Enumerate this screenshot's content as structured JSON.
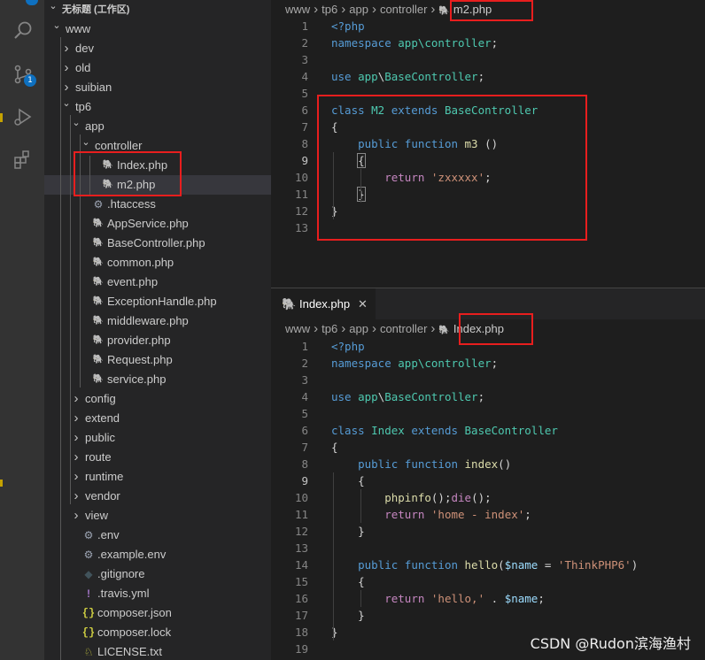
{
  "activity_bar": {
    "icons": [
      "explorer-icon",
      "search-icon",
      "source-control-icon",
      "run-debug-icon",
      "extensions-icon"
    ],
    "scm_badge": "1"
  },
  "sidebar": {
    "workspace_title": "无标题 (工作区)",
    "tree": [
      {
        "label": "www",
        "type": "folder",
        "open": true
      },
      {
        "label": "dev",
        "type": "folder",
        "open": false
      },
      {
        "label": "old",
        "type": "folder",
        "open": false
      },
      {
        "label": "suibian",
        "type": "folder",
        "open": false
      },
      {
        "label": "tp6",
        "type": "folder",
        "open": true
      },
      {
        "label": "app",
        "type": "folder",
        "open": true
      },
      {
        "label": "controller",
        "type": "folder",
        "open": true
      },
      {
        "label": "Index.php",
        "type": "php"
      },
      {
        "label": "m2.php",
        "type": "php",
        "selected": true
      },
      {
        "label": ".htaccess",
        "type": "config"
      },
      {
        "label": "AppService.php",
        "type": "php"
      },
      {
        "label": "BaseController.php",
        "type": "php"
      },
      {
        "label": "common.php",
        "type": "php"
      },
      {
        "label": "event.php",
        "type": "php"
      },
      {
        "label": "ExceptionHandle.php",
        "type": "php"
      },
      {
        "label": "middleware.php",
        "type": "php"
      },
      {
        "label": "provider.php",
        "type": "php"
      },
      {
        "label": "Request.php",
        "type": "php"
      },
      {
        "label": "service.php",
        "type": "php"
      },
      {
        "label": "config",
        "type": "folder",
        "open": false
      },
      {
        "label": "extend",
        "type": "folder",
        "open": false
      },
      {
        "label": "public",
        "type": "folder",
        "open": false
      },
      {
        "label": "route",
        "type": "folder",
        "open": false
      },
      {
        "label": "runtime",
        "type": "folder",
        "open": false
      },
      {
        "label": "vendor",
        "type": "folder",
        "open": false
      },
      {
        "label": "view",
        "type": "folder",
        "open": false
      },
      {
        "label": ".env",
        "type": "config"
      },
      {
        "label": ".example.env",
        "type": "config"
      },
      {
        "label": ".gitignore",
        "type": "git"
      },
      {
        "label": ".travis.yml",
        "type": "yml"
      },
      {
        "label": "composer.json",
        "type": "json"
      },
      {
        "label": "composer.lock",
        "type": "json"
      },
      {
        "label": "LICENSE.txt",
        "type": "license"
      }
    ]
  },
  "editor_top": {
    "breadcrumb": [
      "www",
      "tp6",
      "app",
      "controller",
      "m2.php"
    ],
    "active_line": 9,
    "lines": [
      {
        "n": "1",
        "tokens": [
          [
            "k",
            "<?php"
          ]
        ]
      },
      {
        "n": "2",
        "tokens": [
          [
            "k",
            "namespace "
          ],
          [
            "c",
            "app\\controller"
          ],
          [
            "p",
            ";"
          ]
        ]
      },
      {
        "n": "3",
        "tokens": []
      },
      {
        "n": "4",
        "tokens": [
          [
            "k",
            "use "
          ],
          [
            "c",
            "app"
          ],
          [
            "p",
            "\\"
          ],
          [
            "c",
            "BaseController"
          ],
          [
            "p",
            ";"
          ]
        ]
      },
      {
        "n": "5",
        "tokens": []
      },
      {
        "n": "6",
        "tokens": [
          [
            "k",
            "class "
          ],
          [
            "c",
            "M2 "
          ],
          [
            "k",
            "extends "
          ],
          [
            "c",
            "BaseController"
          ]
        ]
      },
      {
        "n": "7",
        "tokens": [
          [
            "p",
            "{"
          ]
        ]
      },
      {
        "n": "8",
        "tokens": [
          [
            "p",
            "    "
          ],
          [
            "k",
            "public "
          ],
          [
            "k",
            "function "
          ],
          [
            "f",
            "m3"
          ],
          [
            "p",
            " ()"
          ]
        ]
      },
      {
        "n": "9",
        "tokens": [
          [
            "p",
            "    "
          ],
          [
            "pb",
            "{"
          ]
        ]
      },
      {
        "n": "10",
        "tokens": [
          [
            "p",
            "        "
          ],
          [
            "cf",
            "return "
          ],
          [
            "s",
            "'zxxxxx'"
          ],
          [
            "p",
            ";"
          ]
        ]
      },
      {
        "n": "11",
        "tokens": [
          [
            "p",
            "    "
          ],
          [
            "pb",
            "}"
          ]
        ]
      },
      {
        "n": "12",
        "tokens": [
          [
            "p",
            "}"
          ]
        ]
      },
      {
        "n": "13",
        "tokens": []
      }
    ]
  },
  "editor_bottom": {
    "tab": {
      "label": "Index.php",
      "close": "✕"
    },
    "breadcrumb": [
      "www",
      "tp6",
      "app",
      "controller",
      "Index.php"
    ],
    "active_line": 9,
    "lines": [
      {
        "n": "1",
        "tokens": [
          [
            "k",
            "<?php"
          ]
        ]
      },
      {
        "n": "2",
        "tokens": [
          [
            "k",
            "namespace "
          ],
          [
            "c",
            "app\\controller"
          ],
          [
            "p",
            ";"
          ]
        ]
      },
      {
        "n": "3",
        "tokens": []
      },
      {
        "n": "4",
        "tokens": [
          [
            "k",
            "use "
          ],
          [
            "c",
            "app"
          ],
          [
            "p",
            "\\"
          ],
          [
            "c",
            "BaseController"
          ],
          [
            "p",
            ";"
          ]
        ]
      },
      {
        "n": "5",
        "tokens": []
      },
      {
        "n": "6",
        "tokens": [
          [
            "k",
            "class "
          ],
          [
            "c",
            "Index "
          ],
          [
            "k",
            "extends "
          ],
          [
            "c",
            "BaseController"
          ]
        ]
      },
      {
        "n": "7",
        "tokens": [
          [
            "p",
            "{"
          ]
        ]
      },
      {
        "n": "8",
        "tokens": [
          [
            "p",
            "    "
          ],
          [
            "k",
            "public "
          ],
          [
            "k",
            "function "
          ],
          [
            "f",
            "index"
          ],
          [
            "p",
            "()"
          ]
        ]
      },
      {
        "n": "9",
        "tokens": [
          [
            "p",
            "    {"
          ]
        ]
      },
      {
        "n": "10",
        "tokens": [
          [
            "p",
            "        "
          ],
          [
            "f",
            "phpinfo"
          ],
          [
            "p",
            "();"
          ],
          [
            "cf",
            "die"
          ],
          [
            "p",
            "();"
          ]
        ]
      },
      {
        "n": "11",
        "tokens": [
          [
            "p",
            "        "
          ],
          [
            "cf",
            "return "
          ],
          [
            "s",
            "'home - index'"
          ],
          [
            "p",
            ";"
          ]
        ]
      },
      {
        "n": "12",
        "tokens": [
          [
            "p",
            "    }"
          ]
        ]
      },
      {
        "n": "13",
        "tokens": []
      },
      {
        "n": "14",
        "tokens": [
          [
            "p",
            "    "
          ],
          [
            "k",
            "public "
          ],
          [
            "k",
            "function "
          ],
          [
            "f",
            "hello"
          ],
          [
            "p",
            "("
          ],
          [
            "v",
            "$name"
          ],
          [
            "p",
            " = "
          ],
          [
            "s",
            "'ThinkPHP6'"
          ],
          [
            "p",
            ")"
          ]
        ]
      },
      {
        "n": "15",
        "tokens": [
          [
            "p",
            "    {"
          ]
        ]
      },
      {
        "n": "16",
        "tokens": [
          [
            "p",
            "        "
          ],
          [
            "cf",
            "return "
          ],
          [
            "s",
            "'hello,'"
          ],
          [
            "p",
            " . "
          ],
          [
            "v",
            "$name"
          ],
          [
            "p",
            ";"
          ]
        ]
      },
      {
        "n": "17",
        "tokens": [
          [
            "p",
            "    }"
          ]
        ]
      },
      {
        "n": "18",
        "tokens": [
          [
            "p",
            "}"
          ]
        ]
      },
      {
        "n": "19",
        "tokens": []
      }
    ]
  },
  "watermark": "CSDN @Rudon滨海渔村",
  "colors": {
    "annotation_red": "#e81e1e",
    "php_icon": "#a074c4",
    "keyword": "#569cd6",
    "class": "#4ec9b0",
    "function": "#dcdcaa",
    "string": "#ce9178"
  }
}
